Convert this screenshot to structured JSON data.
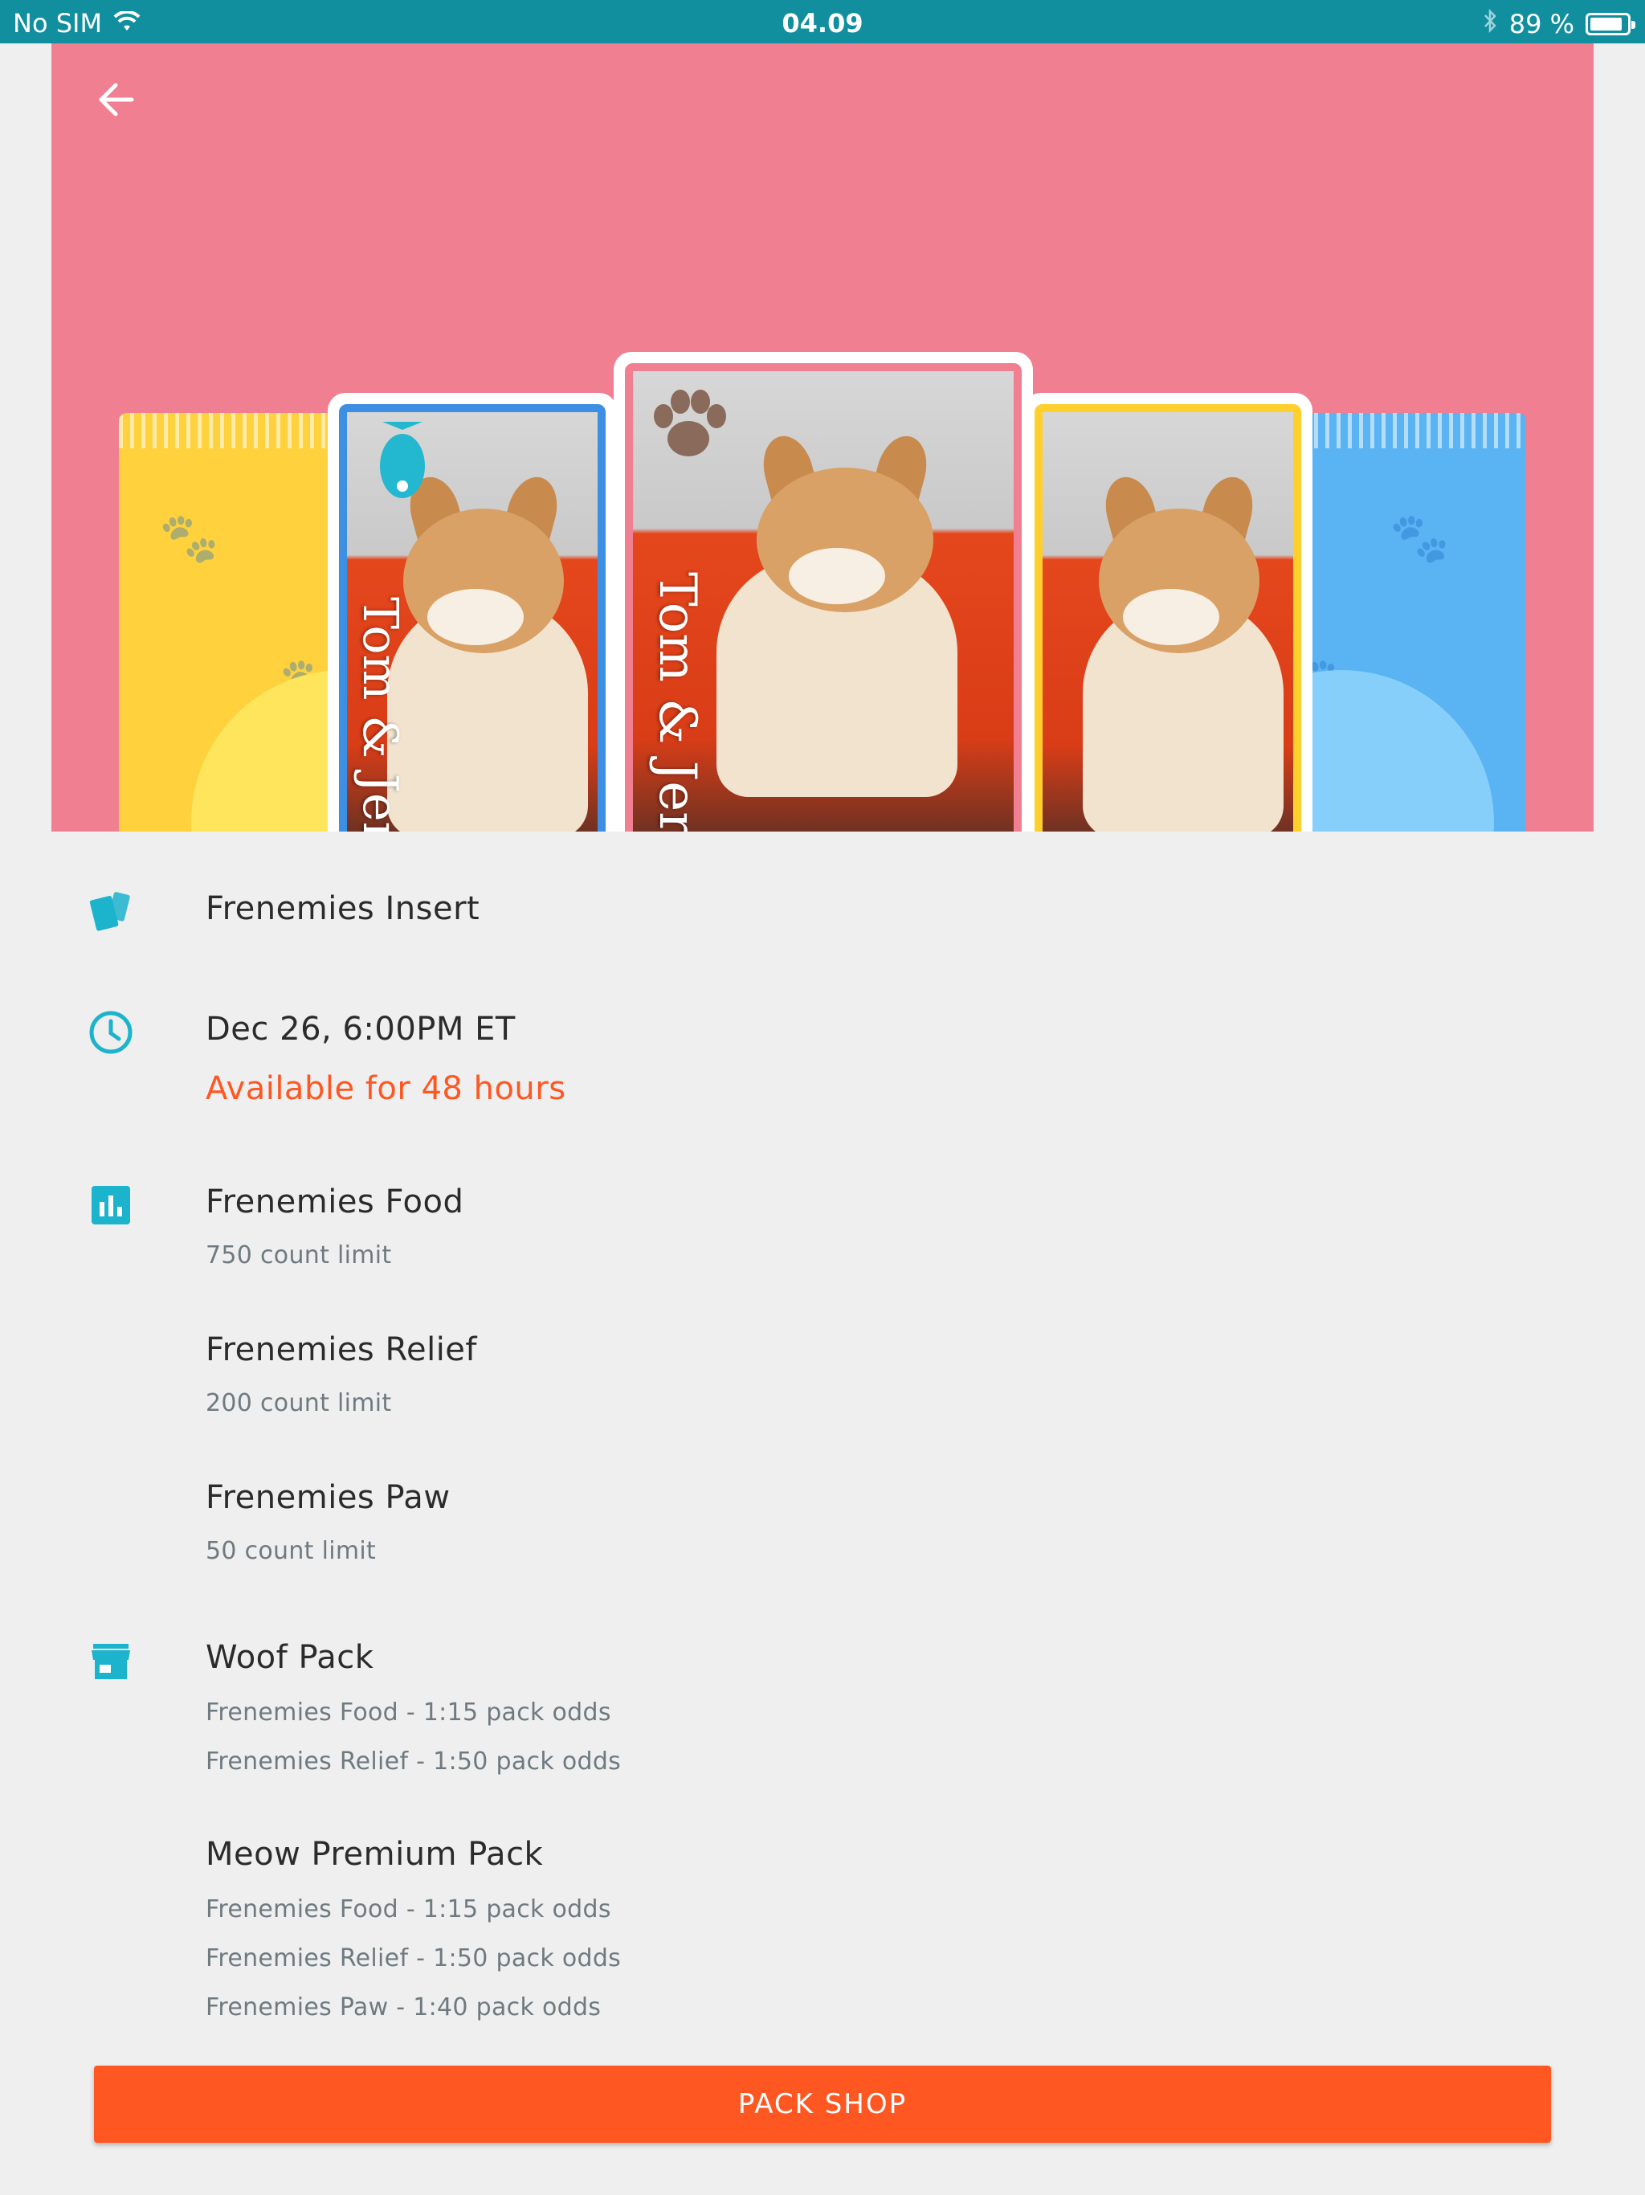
{
  "status_bar": {
    "carrier": "No SIM",
    "time": "04.09",
    "battery_percent": "89 %",
    "battery_level": 0.89
  },
  "colors": {
    "status_bar": "#118f9f",
    "hero_background": "#f07f91",
    "accent": "#1cb3cc",
    "highlight": "#ff5722",
    "button": "#ff5722"
  },
  "hero": {
    "card_title": "Tom & Jerry"
  },
  "insert": {
    "icon": "cards-icon",
    "name": "Frenemies Insert"
  },
  "release": {
    "icon": "clock-icon",
    "date": "Dec 26, 6:00PM ET",
    "availability": "Available for 48 hours"
  },
  "limits": {
    "icon": "bar-chart-icon",
    "items": [
      {
        "name": "Frenemies Food",
        "limit": "750 count limit"
      },
      {
        "name": "Frenemies Relief",
        "limit": "200 count limit"
      },
      {
        "name": "Frenemies Paw",
        "limit": "50 count limit"
      }
    ]
  },
  "packs": {
    "icon": "store-icon",
    "items": [
      {
        "name": "Woof Pack",
        "odds": [
          "Frenemies Food - 1:15 pack odds",
          "Frenemies Relief - 1:50 pack odds"
        ]
      },
      {
        "name": "Meow Premium Pack",
        "odds": [
          "Frenemies Food - 1:15 pack odds",
          "Frenemies Relief - 1:50 pack odds",
          "Frenemies Paw - 1:40 pack odds"
        ]
      }
    ]
  },
  "pack_shop_button": "PACK SHOP"
}
